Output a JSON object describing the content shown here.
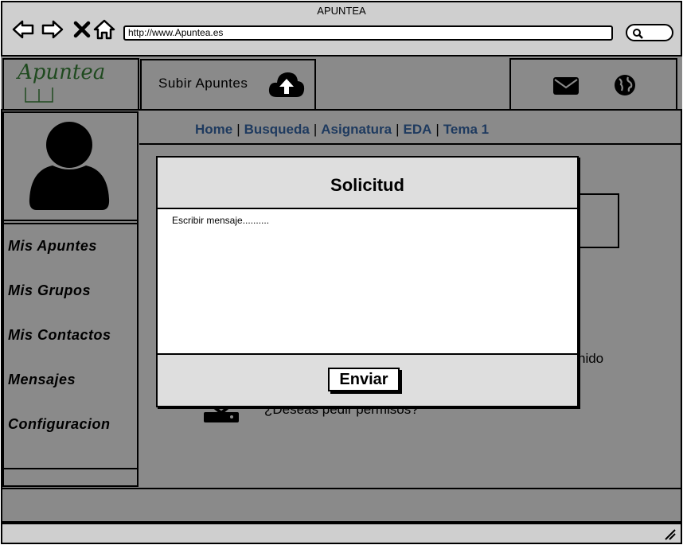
{
  "window": {
    "title": "APUNTEA"
  },
  "browser": {
    "url": "http://www.Apuntea.es"
  },
  "header": {
    "logo_text": "Apuntea",
    "upload_label": "Subir Apuntes"
  },
  "sidebar": {
    "items": [
      {
        "label": "Mis Apuntes"
      },
      {
        "label": "Mis Grupos"
      },
      {
        "label": "Mis Contactos"
      },
      {
        "label": "Mensajes"
      },
      {
        "label": "Configuracion"
      }
    ]
  },
  "breadcrumb": [
    "Home",
    "Busqueda",
    "Asignatura",
    "EDA",
    "Tema 1"
  ],
  "background": {
    "partial_text": "nido",
    "permission_text": "¿Deseas pedir permisos?"
  },
  "modal": {
    "title": "Solicitud",
    "message_placeholder": "Escribir mensaje..........",
    "send_label": "Enviar"
  },
  "colors": {
    "link": "#1e3a5f",
    "logo": "#1f4a1f",
    "backdrop": "#8a8a8a",
    "panel": "#dedede"
  }
}
